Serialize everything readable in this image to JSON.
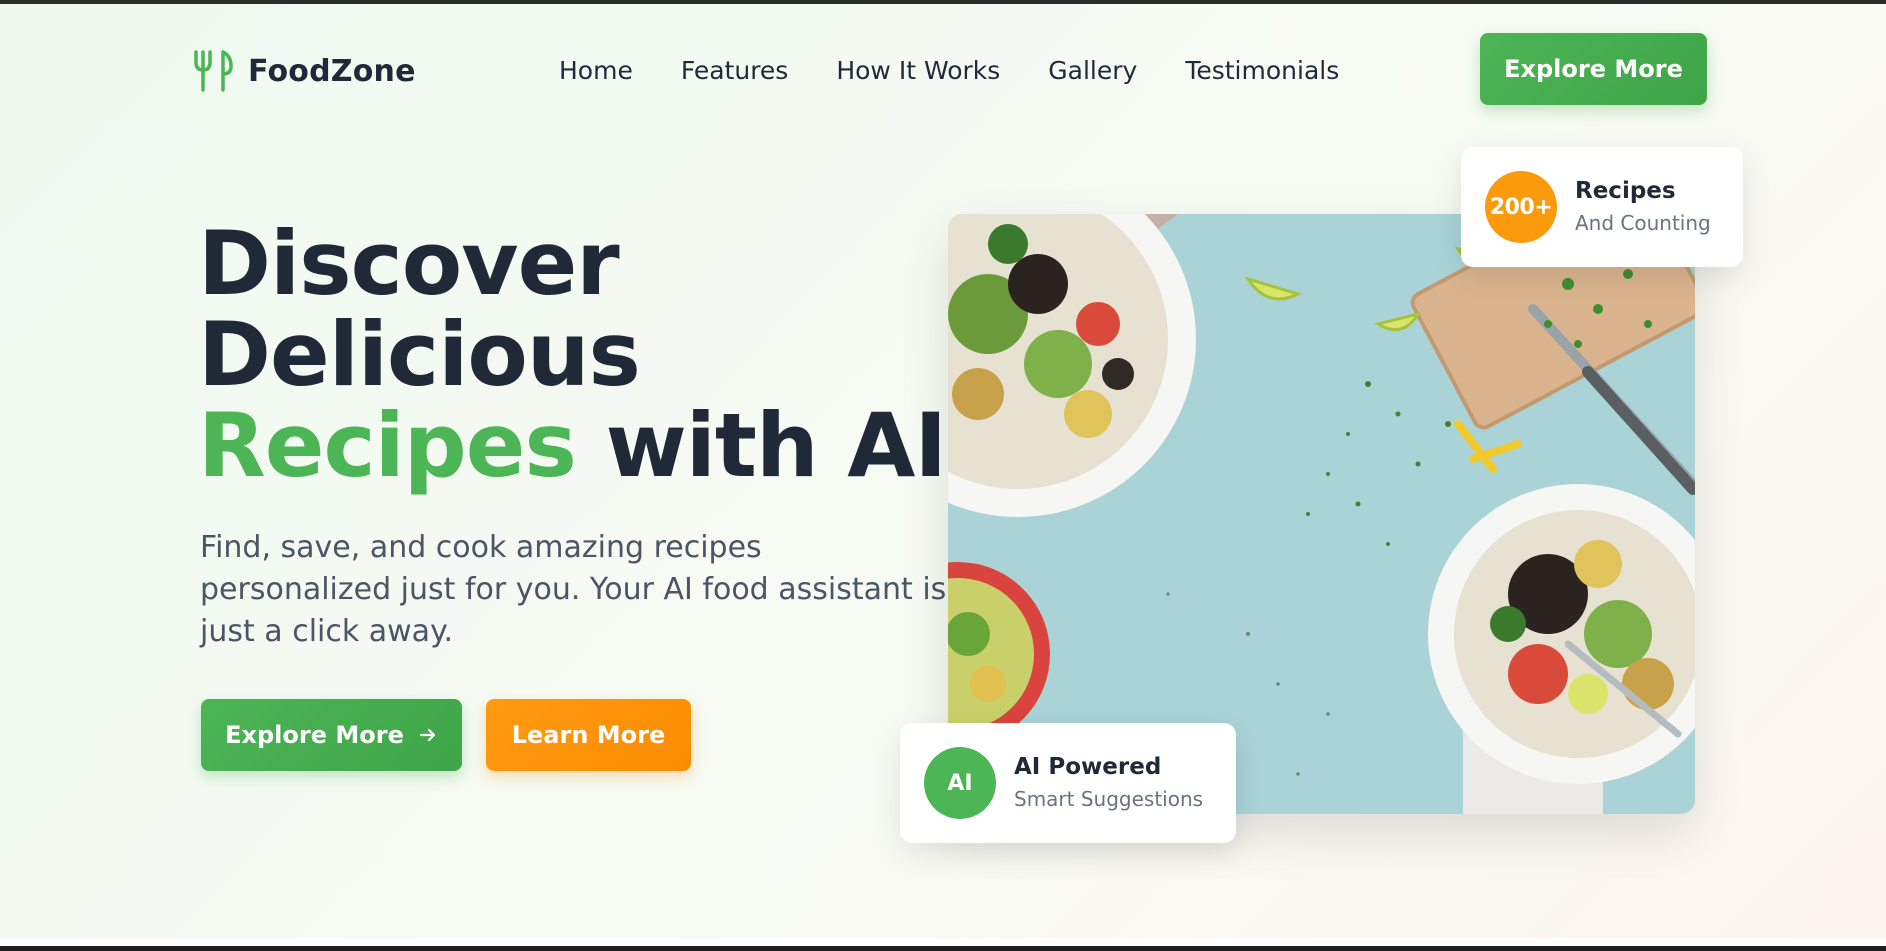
{
  "brand": {
    "name": "FoodZone",
    "icon": "fork-knife-icon",
    "color": "#4cb556"
  },
  "nav": {
    "links": [
      "Home",
      "Features",
      "How It Works",
      "Gallery",
      "Testimonials"
    ],
    "cta_label": "Explore More"
  },
  "hero": {
    "title_line1": "Discover",
    "title_line2": "Delicious",
    "title_accent": "Recipes",
    "title_rest": "with AI",
    "subtitle": "Find, save, and cook amazing recipes personalized just for you. Your AI food assistant is just a click away.",
    "primary_label": "Explore More",
    "primary_icon": "arrow-right-icon",
    "secondary_label": "Learn More"
  },
  "stats_card": {
    "badge": "200+",
    "title": "Recipes",
    "subtitle": "And Counting"
  },
  "ai_card": {
    "badge": "AI",
    "title": "AI Powered",
    "subtitle": "Smart Suggestions"
  },
  "colors": {
    "accent_green": "#4cb556",
    "accent_orange": "#fb9a0c",
    "text_dark": "#1f2937",
    "text_muted": "#4b5563"
  }
}
